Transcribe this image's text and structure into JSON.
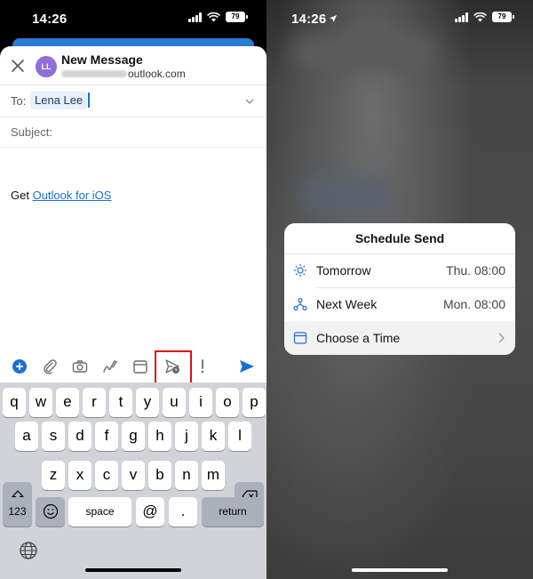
{
  "left": {
    "status": {
      "time": "14:26",
      "battery": "79"
    },
    "compose": {
      "title": "New Message",
      "avatar_initials": "LL",
      "from_suffix": "outlook.com",
      "to_label": "To:",
      "to_recipient": "Lena Lee",
      "subject_label": "Subject:",
      "signature_prefix": "Get",
      "signature_link": "Outlook for iOS"
    },
    "toolbar": {
      "icons": [
        "add-icon",
        "attachment-icon",
        "camera-icon",
        "draw-icon",
        "calendar-icon",
        "schedule-send-icon",
        "importance-icon",
        "send-icon"
      ],
      "highlight_color": "#e01010"
    },
    "keyboard": {
      "row1": [
        "q",
        "w",
        "e",
        "r",
        "t",
        "y",
        "u",
        "i",
        "o",
        "p"
      ],
      "row2": [
        "a",
        "s",
        "d",
        "f",
        "g",
        "h",
        "j",
        "k",
        "l"
      ],
      "row3": [
        "z",
        "x",
        "c",
        "v",
        "b",
        "n",
        "m"
      ],
      "numbers": "123",
      "space": "space",
      "at": "@",
      "dot": ".",
      "return": "return"
    }
  },
  "right": {
    "status": {
      "time": "14:26",
      "battery": "79"
    },
    "schedule": {
      "title": "Schedule Send",
      "items": [
        {
          "label": "Tomorrow",
          "value": "Thu. 08:00",
          "icon": "sun-icon"
        },
        {
          "label": "Next Week",
          "value": "Mon. 08:00",
          "icon": "network-icon"
        },
        {
          "label": "Choose a Time",
          "value": "",
          "icon": "calendar-icon"
        }
      ]
    }
  },
  "colors": {
    "accent": "#1a6ed6",
    "chip": "#e8f0fb",
    "avatar": "#8f6fd8"
  }
}
